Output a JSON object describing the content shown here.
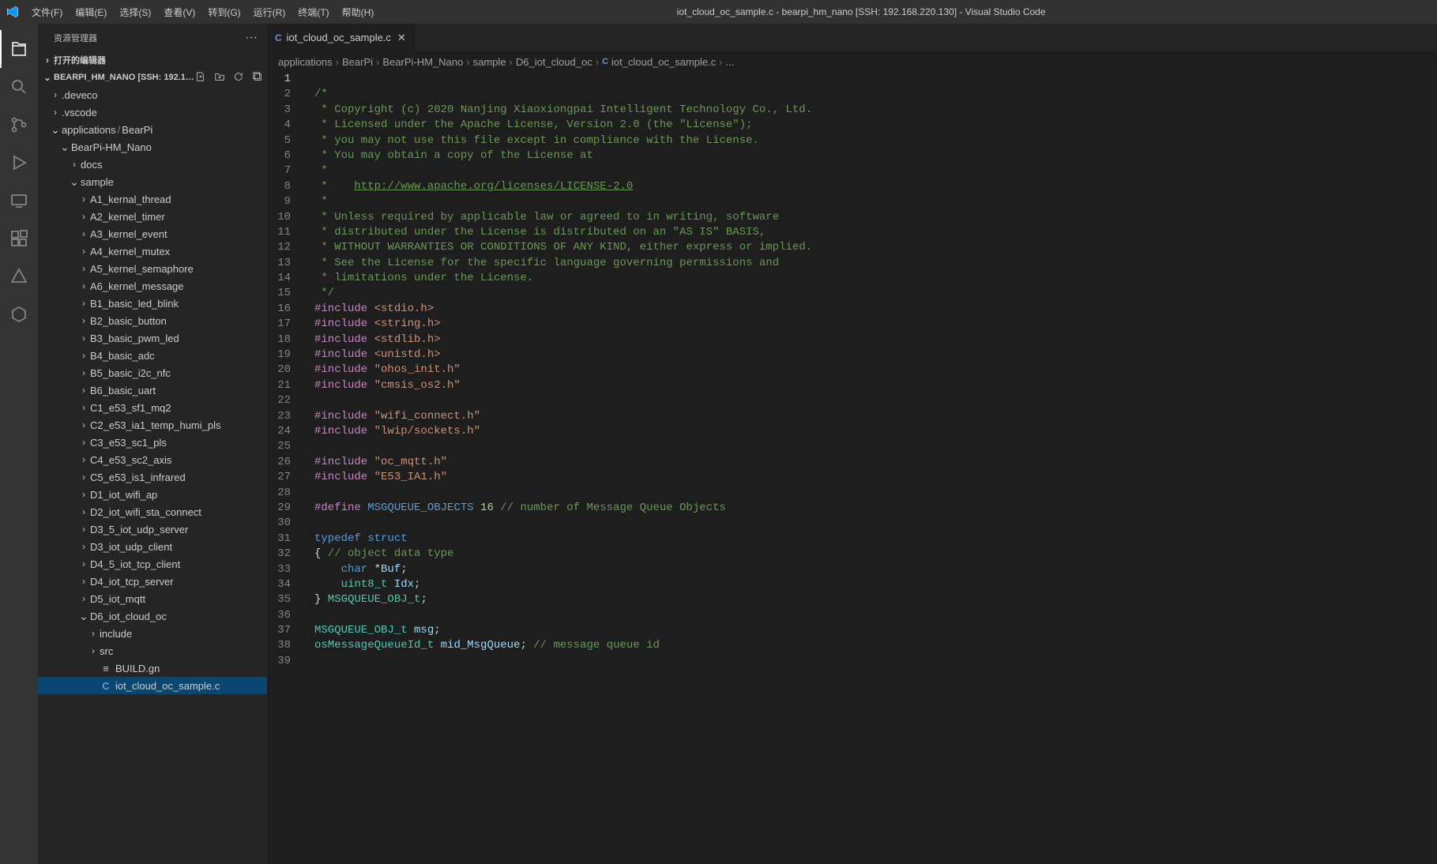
{
  "window": {
    "title": "iot_cloud_oc_sample.c - bearpi_hm_nano [SSH: 192.168.220.130] - Visual Studio Code"
  },
  "menubar": {
    "file": "文件(F)",
    "edit": "编辑(E)",
    "selection": "选择(S)",
    "view": "查看(V)",
    "go": "转到(G)",
    "run": "运行(R)",
    "terminal": "终端(T)",
    "help": "帮助(H)"
  },
  "sidebar": {
    "title": "资源管理器",
    "openEditors": "打开的编辑器",
    "project": "BEARPI_HM_NANO [SSH: 192.16...",
    "tree": {
      "deveco": ".deveco",
      "vscode": ".vscode",
      "applications": "applications",
      "bearpi": "BearPi",
      "bearpihm": "BearPi-HM_Nano",
      "docs": "docs",
      "sample": "sample",
      "a1": "A1_kernal_thread",
      "a2": "A2_kernel_timer",
      "a3": "A3_kernel_event",
      "a4": "A4_kernel_mutex",
      "a5": "A5_kernel_semaphore",
      "a6": "A6_kernel_message",
      "b1": "B1_basic_led_blink",
      "b2": "B2_basic_button",
      "b3": "B3_basic_pwm_led",
      "b4": "B4_basic_adc",
      "b5": "B5_basic_i2c_nfc",
      "b6": "B6_basic_uart",
      "c1": "C1_e53_sf1_mq2",
      "c2": "C2_e53_ia1_temp_humi_pls",
      "c3": "C3_e53_sc1_pls",
      "c4": "C4_e53_sc2_axis",
      "c5": "C5_e53_is1_infrared",
      "d1": "D1_iot_wifi_ap",
      "d2": "D2_iot_wifi_sta_connect",
      "d35": "D3_5_iot_udp_server",
      "d3": "D3_iot_udp_client",
      "d45": "D4_5_iot_tcp_client",
      "d4": "D4_iot_tcp_server",
      "d5": "D5_iot_mqtt",
      "d6": "D6_iot_cloud_oc",
      "include": "include",
      "src": "src",
      "buildgn": "BUILD.gn",
      "samplefile": "iot_cloud_oc_sample.c"
    }
  },
  "tab": {
    "icon": "C",
    "label": "iot_cloud_oc_sample.c"
  },
  "breadcrumbs": {
    "b0": "applications",
    "b1": "BearPi",
    "b2": "BearPi-HM_Nano",
    "b3": "sample",
    "b4": "D6_iot_cloud_oc",
    "b5icon": "C",
    "b5": "iot_cloud_oc_sample.c",
    "b6": "..."
  },
  "code": {
    "l2": "/*",
    "l3": " * Copyright (c) 2020 Nanjing Xiaoxiongpai Intelligent Technology Co., Ltd.",
    "l4": " * Licensed under the Apache License, Version 2.0 (the \"License\");",
    "l5": " * you may not use this file except in compliance with the License.",
    "l6": " * You may obtain a copy of the License at",
    "l7": " *",
    "l8a": " *    ",
    "l8b": "http://www.apache.org/licenses/LICENSE-2.0",
    "l9": " *",
    "l10": " * Unless required by applicable law or agreed to in writing, software",
    "l11": " * distributed under the License is distributed on an \"AS IS\" BASIS,",
    "l12": " * WITHOUT WARRANTIES OR CONDITIONS OF ANY KIND, either express or implied.",
    "l13": " * See the License for the specific language governing permissions and",
    "l14": " * limitations under the License.",
    "l15": " */",
    "inc": "#include",
    "h16": " <stdio.h>",
    "h17": " <string.h>",
    "h18": " <stdlib.h>",
    "h19": " <unistd.h>",
    "h20": " \"ohos_init.h\"",
    "h21": " \"cmsis_os2.h\"",
    "h23": " \"wifi_connect.h\"",
    "h24": " \"lwip/sockets.h\"",
    "h26": " \"oc_mqtt.h\"",
    "h27": " \"E53_IA1.h\"",
    "define": "#define",
    "l29a": " MSGQUEUE_OBJECTS",
    "l29b": " 16",
    "l29c": " // number of Message Queue Objects",
    "l31a": "typedef",
    "l31b": " struct",
    "l32a": "{",
    "l32b": " // object data type",
    "l33a": "    char",
    "l33b": " *",
    "l33c": "Buf",
    "l33d": ";",
    "l34a": "    uint8_t",
    "l34b": " Idx",
    "l34c": ";",
    "l35a": "}",
    "l35b": " MSGQUEUE_OBJ_t",
    "l35c": ";",
    "l37a": "MSGQUEUE_OBJ_t",
    "l37b": " msg",
    "l37c": ";",
    "l38a": "osMessageQueueId_t",
    "l38b": " mid_MsgQueue",
    "l38c": ";",
    "l38d": " // message queue id"
  }
}
